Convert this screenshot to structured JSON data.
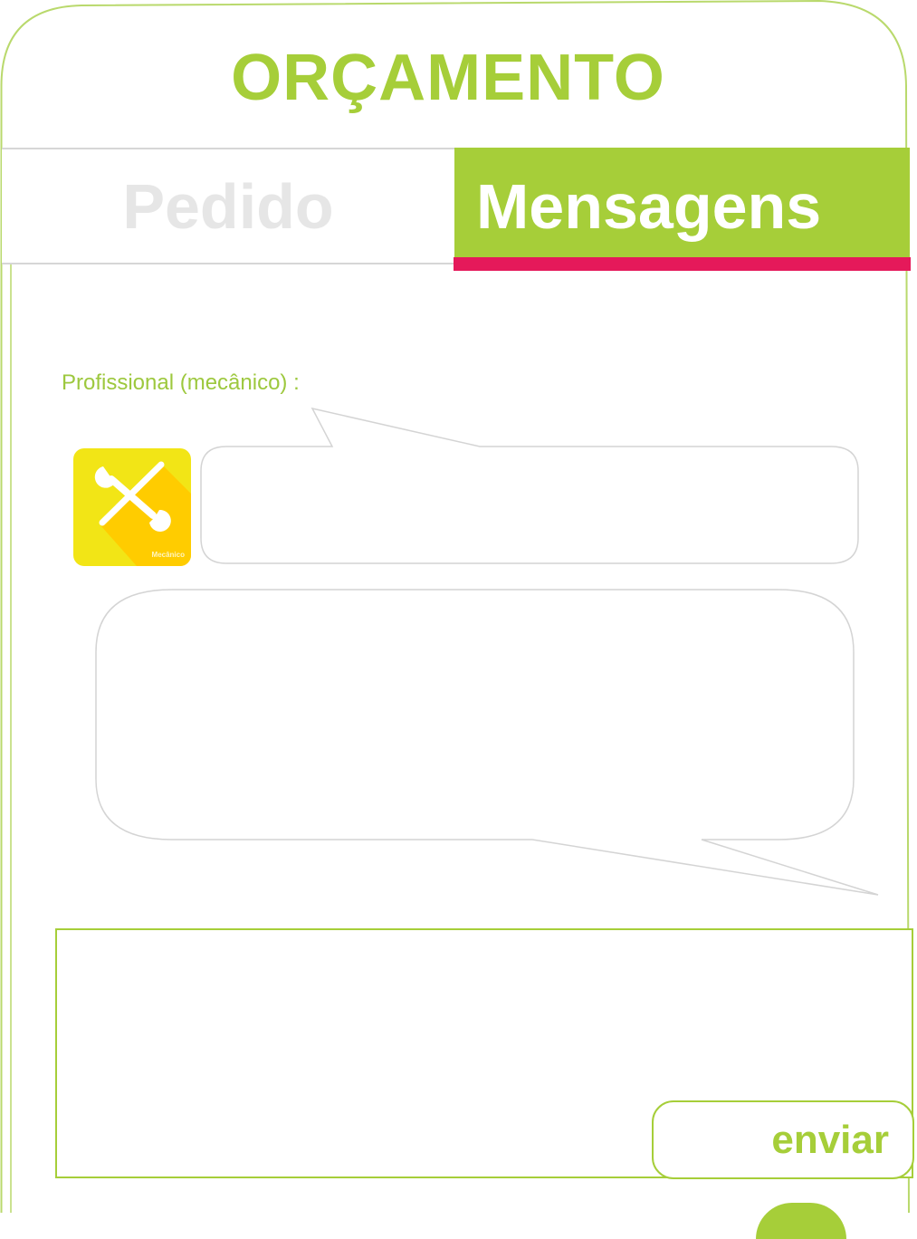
{
  "header": {
    "title": "ORÇAMENTO"
  },
  "tabs": [
    {
      "label": "Pedido",
      "active": false
    },
    {
      "label": "Mensagens",
      "active": true
    }
  ],
  "conversation": {
    "sender_label": "Profissional (mecânico) :",
    "avatar": {
      "icon": "wrench-screwdriver-icon",
      "caption": "Mecânico"
    },
    "received_message": "",
    "sent_message": ""
  },
  "compose": {
    "message_value": "",
    "send_label": "enviar"
  },
  "colors": {
    "accent": "#a6ce39",
    "tab_underline": "#e5195a",
    "inactive_tab_text": "#e6e6e6",
    "bubble_border": "#d4d4d4",
    "avatar_yellow": "#f2e516",
    "avatar_shadow": "#ffcc00"
  }
}
